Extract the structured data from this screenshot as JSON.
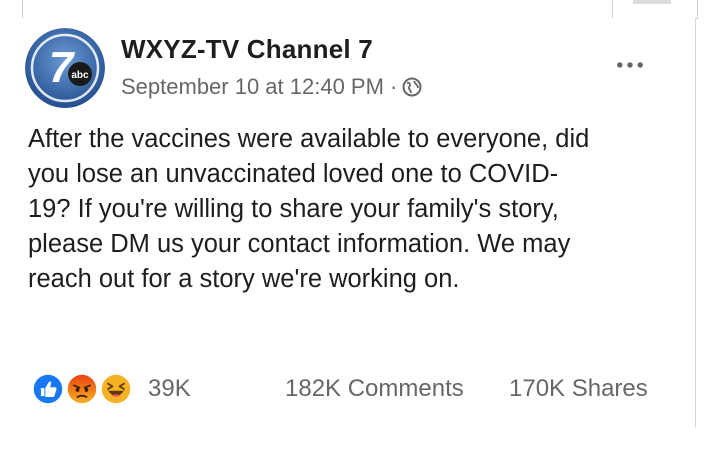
{
  "post": {
    "page_name": "WXYZ-TV Channel 7",
    "timestamp": "September 10 at 12:40 PM",
    "separator": "·",
    "audience_icon": "globe-icon",
    "more_icon": "ellipsis-icon",
    "avatar": {
      "logo_number": "7",
      "logo_badge": "abc"
    },
    "text_lines": [
      "After the vaccines were available to everyone, did",
      "you lose an unvaccinated loved one to COVID-",
      "19? If you're willing to share your family's story,",
      "please DM us your contact information. We may",
      "reach out for a story we're working on."
    ]
  },
  "engagement": {
    "reaction_icons": [
      "like-icon",
      "angry-icon",
      "haha-icon"
    ],
    "reaction_count": "39K",
    "comments": "182K Comments",
    "shares": "170K Shares"
  },
  "colors": {
    "text_primary": "#1c1e21",
    "text_secondary": "#65676b",
    "like_blue": "#1877f2",
    "angry_orange": "#e9710f",
    "haha_yellow": "#f7b125",
    "avatar_blue": "#3a6fb0"
  }
}
